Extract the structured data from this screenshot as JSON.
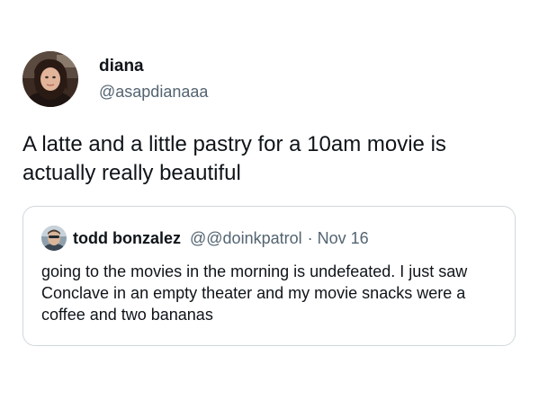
{
  "tweet": {
    "author": {
      "display_name": "diana",
      "handle": "@asapdianaaa"
    },
    "text": "A latte and a little pastry for a 10am movie is actually really beautiful"
  },
  "quote": {
    "author": {
      "display_name": "todd bonzalez",
      "handle": "@@doinkpatrol"
    },
    "separator": "·",
    "date": "Nov 16",
    "text": "going to the movies in the morning is undefeated. I just saw Conclave in an empty theater and my movie snacks were a coffee and two bananas"
  },
  "colors": {
    "text_primary": "#0f1419",
    "text_secondary": "#536471",
    "card_border": "#cfd9de"
  }
}
